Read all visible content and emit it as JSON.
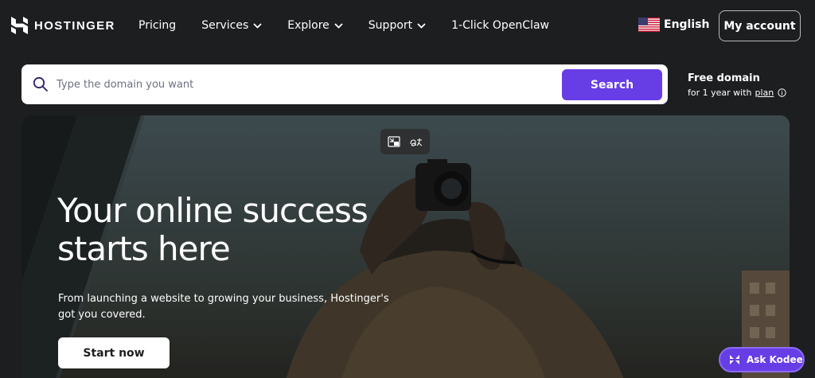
{
  "brand": {
    "name": "HOSTINGER"
  },
  "nav": {
    "items": [
      {
        "label": "Pricing",
        "dropdown": false
      },
      {
        "label": "Services",
        "dropdown": true
      },
      {
        "label": "Explore",
        "dropdown": true
      },
      {
        "label": "Support",
        "dropdown": true
      },
      {
        "label": "1-Click OpenClaw",
        "dropdown": false
      }
    ],
    "language": {
      "label": "English",
      "icon": "us-flag-icon"
    },
    "account_label": "My account"
  },
  "search": {
    "placeholder": "Type the domain you want",
    "value": "",
    "button_label": "Search"
  },
  "free_domain": {
    "title": "Free domain",
    "subtitle": "for 1 year with",
    "link": "plan"
  },
  "hero": {
    "title": "Your online success starts here",
    "subtitle": "From launching a website to growing your business, Hostinger's got you covered.",
    "cta_label": "Start now"
  },
  "chat": {
    "label": "Ask Kodee"
  },
  "colors": {
    "accent": "#673de6",
    "background": "#1d1e20"
  }
}
